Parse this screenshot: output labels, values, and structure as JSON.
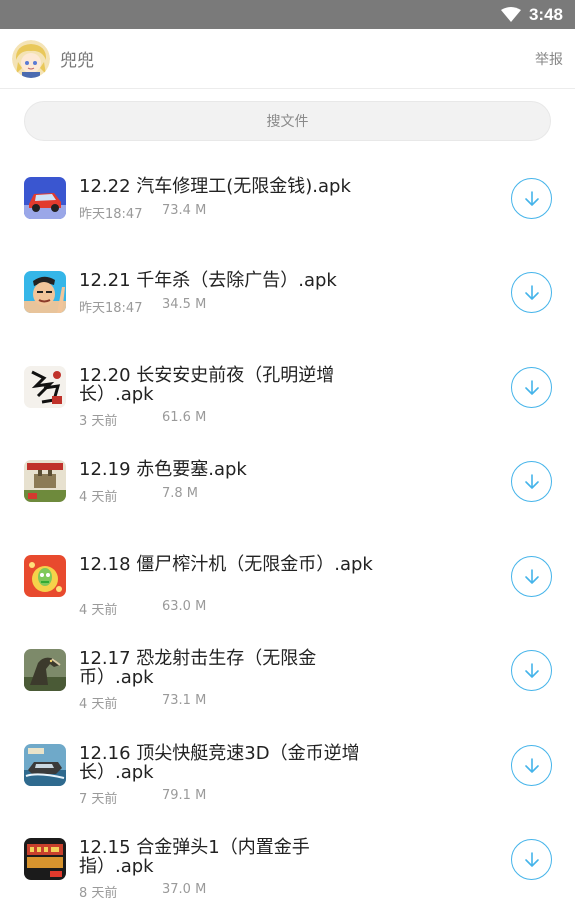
{
  "statusbar": {
    "time": "3:48"
  },
  "header": {
    "name": "兜兜",
    "report": "举报"
  },
  "search": {
    "placeholder": "搜文件"
  },
  "files": [
    {
      "title": "12.22 汽车修理工(无限金钱).apk",
      "date": "昨天18:47",
      "size": "73.4 M",
      "icon": "car-app-icon"
    },
    {
      "title": "12.21 千年杀（去除广告）.apk",
      "date": "昨天18:47",
      "size": "34.5 M",
      "icon": "cartoon-man-app-icon"
    },
    {
      "title": "12.20 长安安史前夜（孔明逆增长）.apk",
      "date": "3 天前",
      "size": "61.6 M",
      "icon": "calligraphy-app-icon"
    },
    {
      "title": "12.19 赤色要塞.apk",
      "date": "4 天前",
      "size": "7.8 M",
      "icon": "fortress-app-icon"
    },
    {
      "title": "12.18 僵尸榨汁机（无限金币）.apk",
      "date": "4 天前",
      "size": "63.0 M",
      "icon": "zombie-app-icon"
    },
    {
      "title": "12.17 恐龙射击生存（无限金币）.apk",
      "date": "4 天前",
      "size": "73.1 M",
      "icon": "dinosaur-app-icon"
    },
    {
      "title": "12.16 顶尖快艇竞速3D（金币逆增长）.apk",
      "date": "7 天前",
      "size": "79.1 M",
      "icon": "speedboat-app-icon"
    },
    {
      "title": "12.15 合金弹头1（内置金手指）.apk",
      "date": "8 天前",
      "size": "37.0 M",
      "icon": "metal-slug-app-icon"
    }
  ],
  "colors": {
    "accent": "#45b4ea",
    "statusbar": "#7a7a7a"
  }
}
